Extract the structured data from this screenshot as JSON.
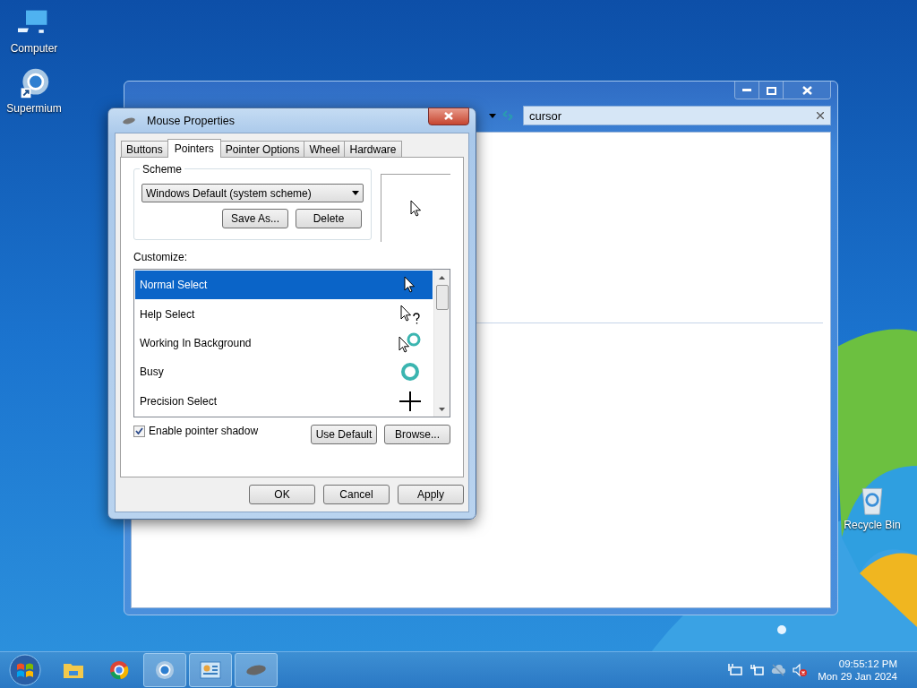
{
  "desktop_icons": [
    {
      "label": "Computer",
      "kind": "computer"
    },
    {
      "label": "Supermium",
      "kind": "browser"
    },
    {
      "label": "Recycle Bin",
      "kind": "recycle"
    }
  ],
  "explorer": {
    "search": {
      "value": "cursor"
    }
  },
  "dialog": {
    "title": "Mouse Properties",
    "tabs": [
      {
        "label": "Buttons",
        "selected": false
      },
      {
        "label": "Pointers",
        "selected": true
      },
      {
        "label": "Pointer Options",
        "selected": false
      },
      {
        "label": "Wheel",
        "selected": false
      },
      {
        "label": "Hardware",
        "selected": false
      }
    ],
    "scheme": {
      "label": "Scheme",
      "value": "Windows Default (system scheme)",
      "buttons": [
        "Save As...",
        "Delete"
      ]
    },
    "customize_label": "Customize:",
    "pointers": [
      {
        "name": "Normal Select",
        "kind": "arrow",
        "selected": true
      },
      {
        "name": "Help Select",
        "kind": "help",
        "selected": false
      },
      {
        "name": "Working In Background",
        "kind": "working",
        "selected": false
      },
      {
        "name": "Busy",
        "kind": "busy",
        "selected": false
      },
      {
        "name": "Precision Select",
        "kind": "cross",
        "selected": false
      }
    ],
    "shadow": {
      "label": "Enable pointer shadow",
      "checked": true
    },
    "list_buttons": [
      "Use Default",
      "Browse..."
    ],
    "footer_buttons": [
      "OK",
      "Cancel",
      "Apply"
    ]
  },
  "taskbar": {
    "apps": [
      {
        "kind": "folder",
        "open": false
      },
      {
        "kind": "chrome",
        "open": false
      },
      {
        "kind": "browser",
        "open": true
      },
      {
        "kind": "panel",
        "open": true
      },
      {
        "kind": "mouse",
        "open": true
      }
    ],
    "time": "09:55:12 PM",
    "date": "Mon 29 Jan 2024"
  }
}
